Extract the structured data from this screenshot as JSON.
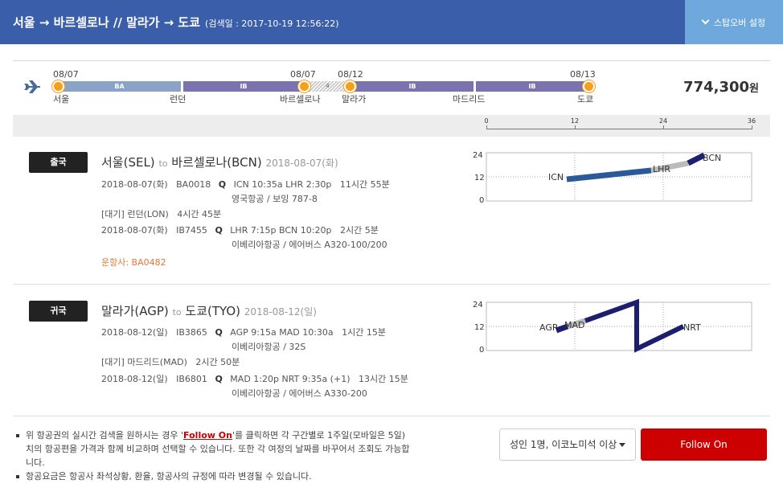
{
  "header": {
    "route": "서울 → 바르셀로나 // 말라가 → 도쿄",
    "search_date": "(검색일 : 2017-10-19 12:56:22)",
    "stopover_label": "스탑오버 설정"
  },
  "timeline": {
    "dates": [
      "08/07",
      "08/07",
      "08/12",
      "08/13"
    ],
    "cities": [
      "서울",
      "런던",
      "바르셀로나",
      "말라가",
      "마드리드",
      "도쿄"
    ],
    "segments": [
      {
        "label": "BA",
        "color": "#8ba3c7"
      },
      {
        "label": "IB",
        "color": "#7a73ad"
      },
      {
        "label": "IB",
        "color": "#7a73ad"
      },
      {
        "label": "IB",
        "color": "#7a73ad"
      }
    ],
    "layover_label": "4",
    "price": "774,300",
    "price_unit": "원"
  },
  "scale": {
    "ticks": [
      "0",
      "12",
      "24",
      "36"
    ]
  },
  "outbound": {
    "badge": "출국",
    "title": "서울(SEL)",
    "to": "to",
    "dest": "바르셀로나(BCN)",
    "date": "2018-08-07(화)",
    "flights": [
      {
        "date": "2018-08-07(화)",
        "no": "BA0018",
        "q": "Q",
        "route": "ICN 10:35a LHR 2:30p",
        "dur": "11시간 55분",
        "aircraft": "영국항공 / 보잉 787-8"
      },
      {
        "date": "2018-08-07(화)",
        "no": "IB7455",
        "q": "Q",
        "route": "LHR 7:15p BCN 10:20p",
        "dur": "2시간 5분",
        "aircraft": "이베리아항공 / 에어버스 A320-100/200"
      }
    ],
    "wait": "[대기] 런던(LON)",
    "wait_dur": "4시간 45분",
    "operator": "운항사: BA0482",
    "chart_labels": [
      "ICN",
      "LHR",
      "BCN"
    ],
    "chart_y": [
      "24",
      "12",
      "0"
    ]
  },
  "return": {
    "badge": "귀국",
    "title": "말라가(AGP)",
    "to": "to",
    "dest": "도쿄(TYO)",
    "date": "2018-08-12(일)",
    "flights": [
      {
        "date": "2018-08-12(일)",
        "no": "IB3865",
        "q": "Q",
        "route": "AGP 9:15a MAD 10:30a",
        "dur": "1시간 15분",
        "aircraft": "이베리아항공 / 32S"
      },
      {
        "date": "2018-08-12(일)",
        "no": "IB6801",
        "q": "Q",
        "route": "MAD 1:20p NRT 9:35a (+1)",
        "dur": "13시간 15분",
        "aircraft": "이베리아항공 / 에어버스 A330-200"
      }
    ],
    "wait": "[대기] 마드리드(MAD)",
    "wait_dur": "2시간 50분",
    "chart_labels": [
      "AGP",
      "MAD",
      "NRT"
    ],
    "chart_y": [
      "24",
      "12",
      "0"
    ]
  },
  "notes": {
    "n1_a": "위 항공권의 실시간 검색을 원하시는 경우 '",
    "n1_link": "Follow On",
    "n1_b": "'를 클릭하면 각 구간별로 1주일(모바일은 5일)치의 항공편을 가격과 함께 비교하며 선택할 수 있습니다. 또한 각 여정의 날짜를 바꾸어서 조회도 가능합니다.",
    "n2": "항공요금은 항공사 좌석상황, 환율, 항공사의 규정에 따라 변경될 수 있습니다."
  },
  "controls": {
    "passenger_select": "성인 1명, 이코노미석 이상",
    "follow_on": "Follow On"
  },
  "colors": {
    "accent": "#3a5ea9",
    "follow": "#cc0000",
    "dot": "#f5a01a",
    "flight": "#2a5a9a"
  }
}
